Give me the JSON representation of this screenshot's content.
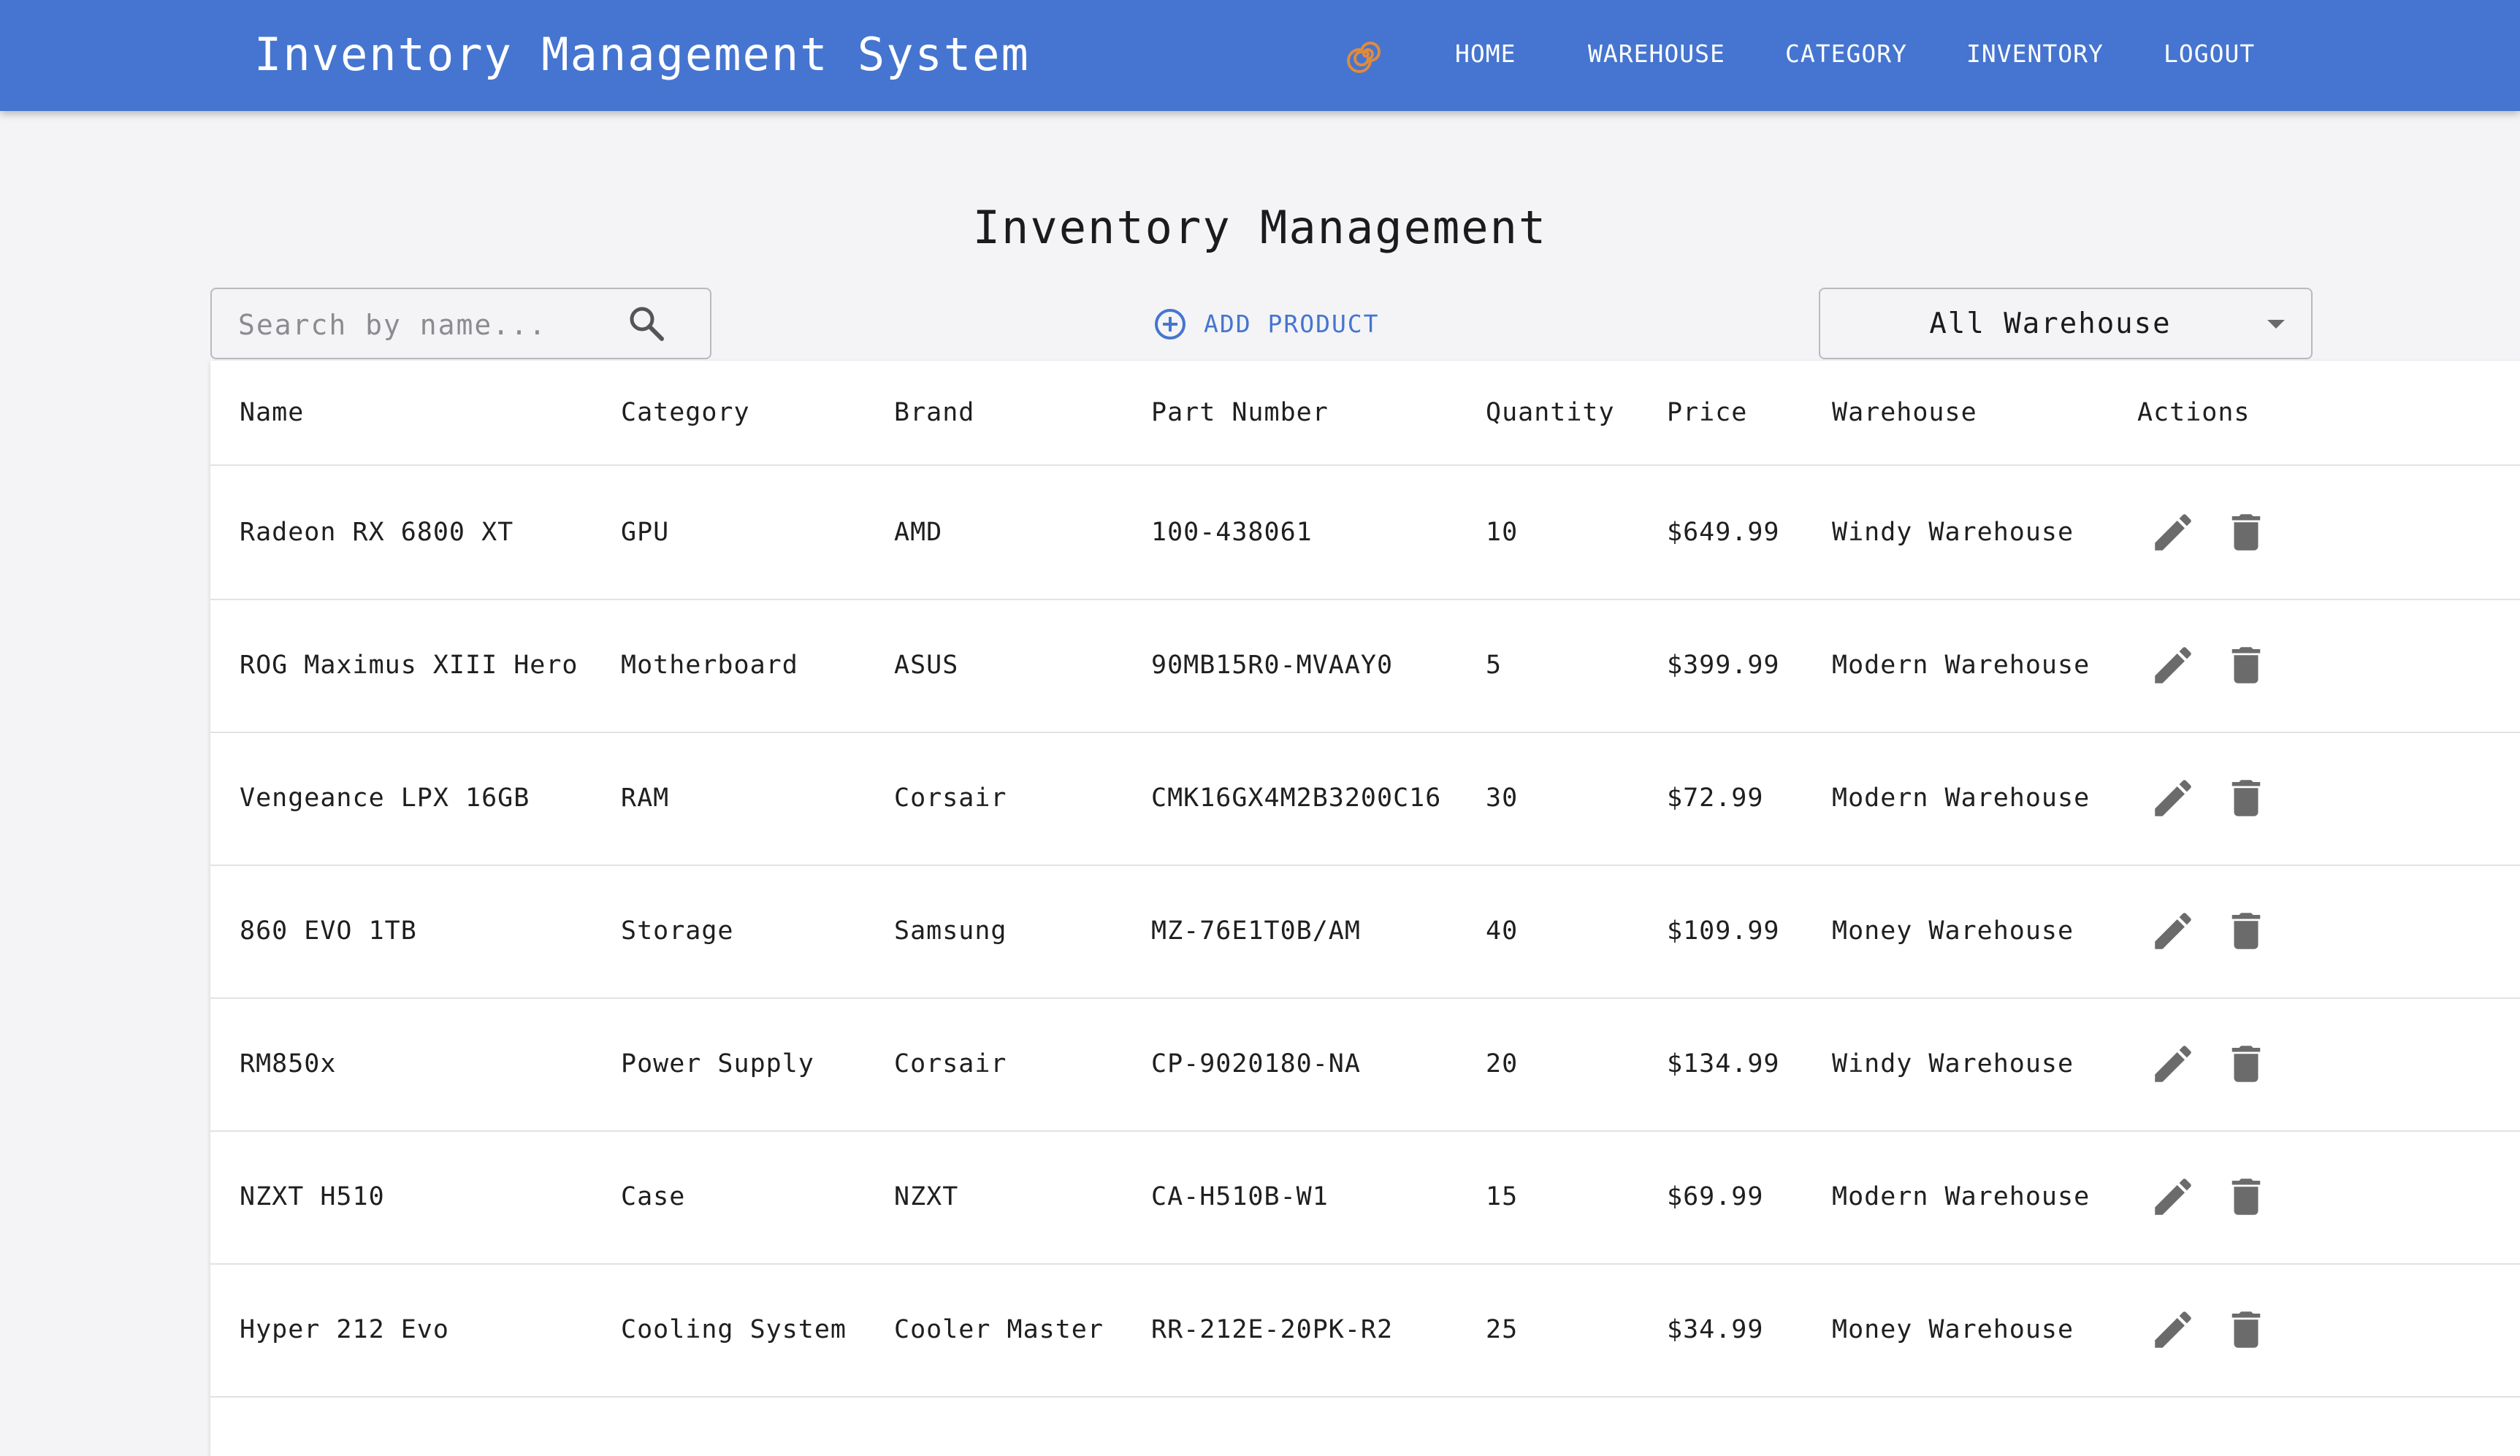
{
  "app": {
    "title": "Inventory Management System",
    "brand_color": "#4575d0",
    "logo_icon": "spiral-logo-icon",
    "logo_color": "#e08a3c"
  },
  "nav": {
    "items": [
      {
        "label": "HOME"
      },
      {
        "label": "WAREHOUSE"
      },
      {
        "label": "CATEGORY"
      },
      {
        "label": "INVENTORY"
      },
      {
        "label": "LOGOUT"
      }
    ]
  },
  "page": {
    "heading": "Inventory Management"
  },
  "toolbar": {
    "search_placeholder": "Search by name...",
    "search_value": "",
    "search_icon": "search-icon",
    "add_product_label": "ADD PRODUCT",
    "add_product_icon": "add-circle-icon",
    "warehouse_filter": {
      "selected": "All Warehouse"
    }
  },
  "table": {
    "columns": [
      "Name",
      "Category",
      "Brand",
      "Part Number",
      "Quantity",
      "Price",
      "Warehouse",
      "Actions"
    ],
    "rows": [
      {
        "name": "Radeon RX 6800 XT",
        "category": "GPU",
        "brand": "AMD",
        "part_number": "100-438061",
        "quantity": "10",
        "price": "$649.99",
        "warehouse": "Windy Warehouse"
      },
      {
        "name": "ROG Maximus XIII Hero",
        "category": "Motherboard",
        "brand": "ASUS",
        "part_number": "90MB15R0-MVAAY0",
        "quantity": "5",
        "price": "$399.99",
        "warehouse": "Modern Warehouse"
      },
      {
        "name": "Vengeance LPX 16GB",
        "category": "RAM",
        "brand": "Corsair",
        "part_number": "CMK16GX4M2B3200C16",
        "quantity": "30",
        "price": "$72.99",
        "warehouse": "Modern Warehouse"
      },
      {
        "name": "860 EVO 1TB",
        "category": "Storage",
        "brand": "Samsung",
        "part_number": "MZ-76E1T0B/AM",
        "quantity": "40",
        "price": "$109.99",
        "warehouse": "Money Warehouse"
      },
      {
        "name": "RM850x",
        "category": "Power Supply",
        "brand": "Corsair",
        "part_number": "CP-9020180-NA",
        "quantity": "20",
        "price": "$134.99",
        "warehouse": "Windy Warehouse"
      },
      {
        "name": "NZXT H510",
        "category": "Case",
        "brand": "NZXT",
        "part_number": "CA-H510B-W1",
        "quantity": "15",
        "price": "$69.99",
        "warehouse": "Modern Warehouse"
      },
      {
        "name": "Hyper 212 Evo",
        "category": "Cooling System",
        "brand": "Cooler Master",
        "part_number": "RR-212E-20PK-R2",
        "quantity": "25",
        "price": "$34.99",
        "warehouse": "Money Warehouse"
      }
    ],
    "row_actions": {
      "edit_icon": "edit-pencil-icon",
      "delete_icon": "trash-icon",
      "icon_color": "#6b6b6b"
    }
  }
}
